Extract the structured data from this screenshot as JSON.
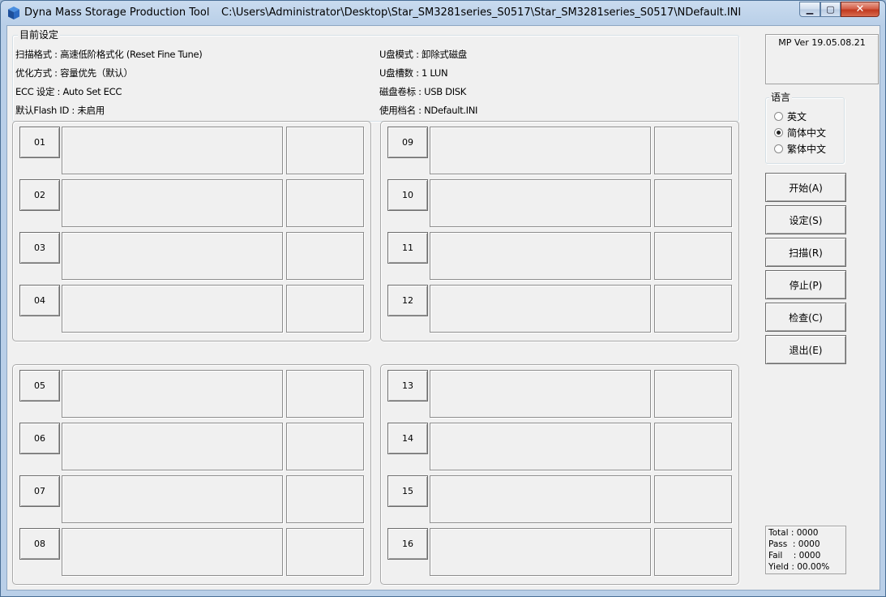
{
  "titlebar": {
    "app_title": "Dyna Mass Storage Production Tool",
    "path": "C:\\Users\\Administrator\\Desktop\\Star_SM3281series_S0517\\Star_SM3281series_S0517\\NDefault.INI",
    "min_glyph": "▁",
    "max_glyph": "▢",
    "close_glyph": "✕"
  },
  "settings": {
    "legend": "目前设定",
    "scan_format": "扫描格式 : 高速低阶格式化 (Reset Fine Tune)",
    "optimize": "优化方式 : 容量优先（默认）",
    "ecc": "ECC 设定 : Auto Set ECC",
    "flash_id": "默认Flash ID : 未启用",
    "udisk_mode": "U盘模式 : 卸除式磁盘",
    "lun_count": "U盘槽数 : 1 LUN",
    "volume_label": "磁盘卷标 : USB DISK",
    "profile_name": "使用档名 : NDefault.INI"
  },
  "version": "MP Ver 19.05.08.21",
  "language": {
    "legend": "语言",
    "options": [
      {
        "label": "英文",
        "checked": false
      },
      {
        "label": "简体中文",
        "checked": true
      },
      {
        "label": "繁体中文",
        "checked": false
      }
    ]
  },
  "buttons": {
    "start": "开始(A)",
    "settings": "设定(S)",
    "scan": "扫描(R)",
    "stop": "停止(P)",
    "check": "检查(C)",
    "exit": "退出(E)"
  },
  "ports": [
    "01",
    "02",
    "03",
    "04",
    "05",
    "06",
    "07",
    "08",
    "09",
    "10",
    "11",
    "12",
    "13",
    "14",
    "15",
    "16"
  ],
  "stats": {
    "total": "Total : 0000",
    "pass": "Pass  : 0000",
    "fail": "Fail    : 0000",
    "yield": "Yield : 00.00%"
  }
}
